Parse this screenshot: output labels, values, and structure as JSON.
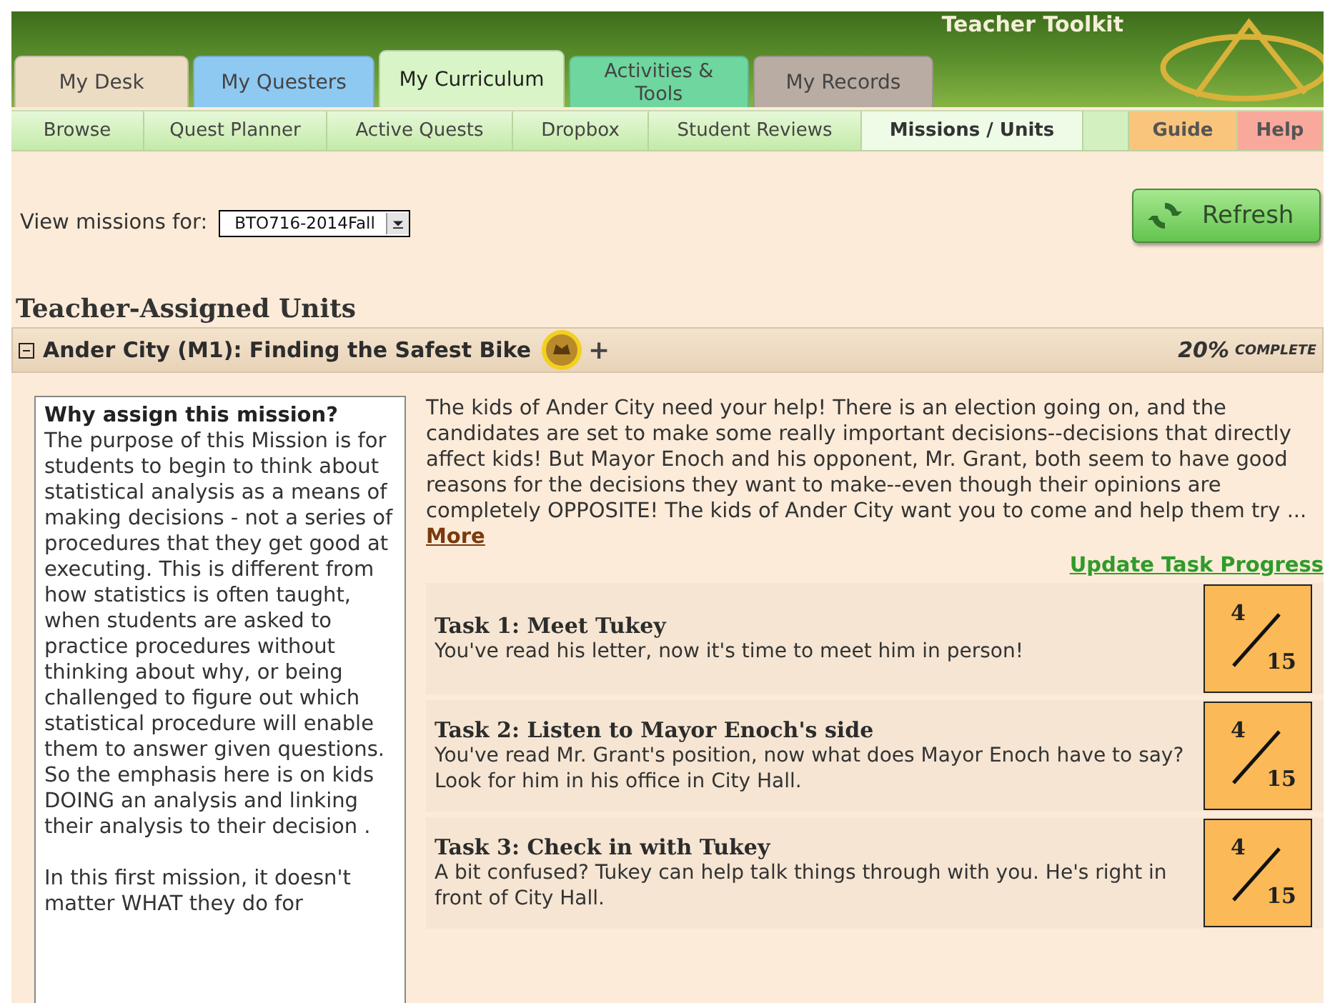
{
  "header": {
    "title": "Teacher Toolkit",
    "tabs": [
      {
        "label": "My Desk",
        "color": "#ecdcc4",
        "selected": false
      },
      {
        "label": "My Questers",
        "color": "#8ec9f2",
        "selected": false
      },
      {
        "label": "My Curriculum",
        "color": "#d9f4c6",
        "selected": true
      },
      {
        "label": "Activities & Tools",
        "color": "#6ed69e",
        "selected": false
      },
      {
        "label": "My Records",
        "color": "#b9aca2",
        "selected": false
      }
    ]
  },
  "subnav": {
    "items": [
      {
        "label": "Browse",
        "selected": false
      },
      {
        "label": "Quest Planner",
        "selected": false
      },
      {
        "label": "Active Quests",
        "selected": false
      },
      {
        "label": "Dropbox",
        "selected": false
      },
      {
        "label": "Student Reviews",
        "selected": false
      },
      {
        "label": "Missions / Units",
        "selected": true
      }
    ],
    "extra_links": [
      {
        "label": "Guide",
        "color": "#f9c57c"
      },
      {
        "label": "Help",
        "color": "#f8a99c"
      }
    ]
  },
  "filter": {
    "label": "View missions for:",
    "value": "BTO716-2014Fall"
  },
  "refresh_button": "Refresh",
  "section_title": "Teacher-Assigned Units",
  "unit": {
    "expanded": true,
    "title": "Ander City (M1): Finding the Safest Bike",
    "add_label": "+",
    "percent": "20%",
    "complete_label": "COMPLETE",
    "why": {
      "title": "Why assign this mission?",
      "paragraphs": [
        "The purpose of this Mission is for students to begin to think about statistical analysis as a means of making decisions - not a series of procedures that they get good at executing. This is different from how statistics is often taught, when students are asked to practice procedures without thinking about why, or being challenged to figure out which statistical procedure will enable them to answer given questions. So the emphasis here is on kids DOING an analysis and linking their analysis to their decision .",
        "In this first mission, it doesn't matter WHAT they do for"
      ]
    },
    "description": "The kids of Ander City need your help! There is an election going on, and the candidates are set to make some really important decisions--decisions that directly affect kids! But Mayor Enoch and his opponent, Mr. Grant, both seem to have good reasons for the decisions they want to make--even though their opinions are completely OPPOSITE! The kids of Ander City want you to come and help them try ...",
    "more_link": "More",
    "update_link": "Update Task Progress",
    "tasks": [
      {
        "title": "Task 1: Meet Tukey",
        "description": "You've read his letter, now it's time to meet him in person!",
        "done": "4",
        "total": "15"
      },
      {
        "title": "Task 2: Listen to Mayor Enoch's side",
        "description": "You've read Mr. Grant's position, now what does Mayor Enoch have to say? Look for him in his office in City Hall.",
        "done": "4",
        "total": "15"
      },
      {
        "title": "Task 3: Check in with Tukey",
        "description": "A bit confused? Tukey can help talk things through with you. He's right in front of City Hall.",
        "done": "4",
        "total": "15"
      }
    ]
  }
}
